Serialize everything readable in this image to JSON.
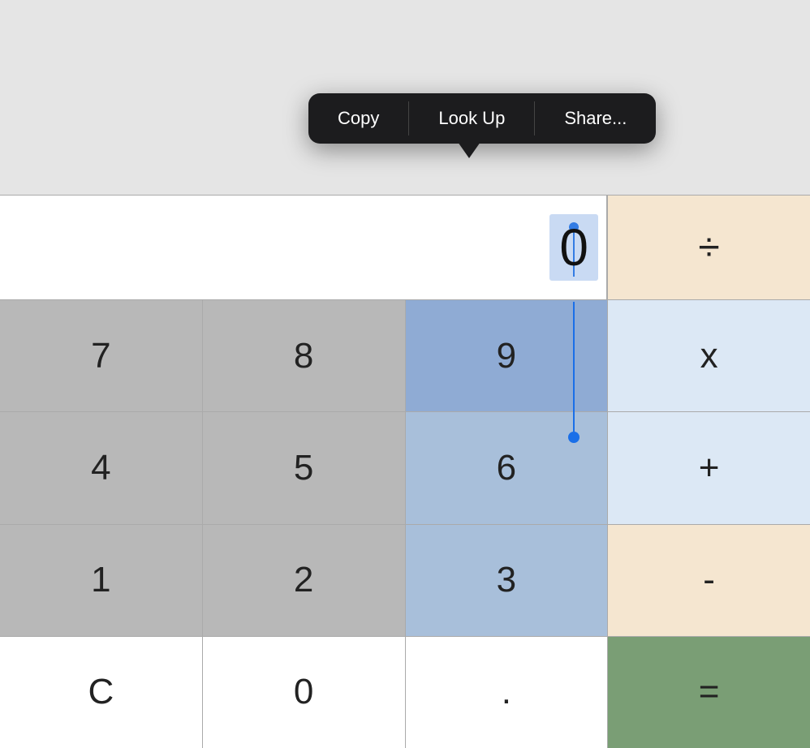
{
  "contextMenu": {
    "items": [
      "Copy",
      "Look Up",
      "Share..."
    ]
  },
  "display": {
    "value": "0",
    "operator": "÷"
  },
  "buttons": {
    "rows": [
      [
        {
          "label": "7",
          "style": "gray"
        },
        {
          "label": "8",
          "style": "gray"
        },
        {
          "label": "9",
          "style": "gray-selected"
        },
        {
          "label": "x",
          "style": "operator-light"
        }
      ],
      [
        {
          "label": "4",
          "style": "gray"
        },
        {
          "label": "5",
          "style": "gray"
        },
        {
          "label": "6",
          "style": "gray-selected-light"
        },
        {
          "label": "+",
          "style": "operator-light"
        }
      ],
      [
        {
          "label": "1",
          "style": "gray"
        },
        {
          "label": "2",
          "style": "gray"
        },
        {
          "label": "3",
          "style": "gray-selected-light"
        },
        {
          "label": "-",
          "style": "operator"
        }
      ],
      [
        {
          "label": "C",
          "style": "white"
        },
        {
          "label": "0",
          "style": "white"
        },
        {
          "label": ".",
          "style": "white"
        },
        {
          "label": "=",
          "style": "equals"
        }
      ]
    ]
  }
}
